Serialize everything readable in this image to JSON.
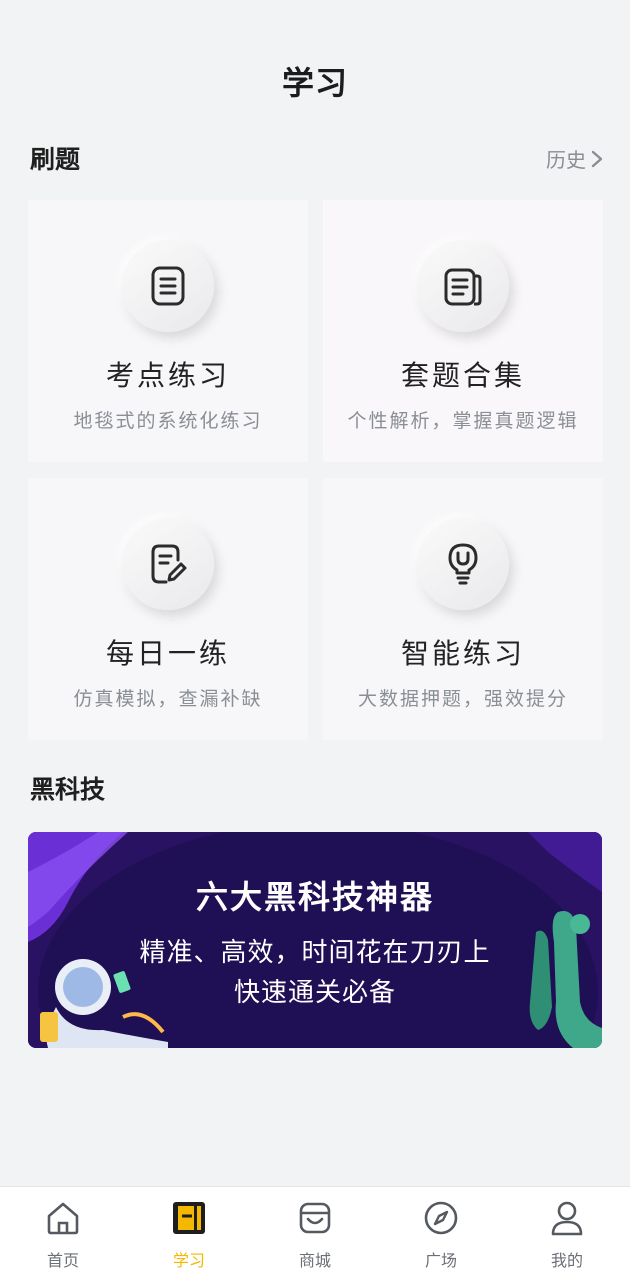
{
  "header": {
    "title": "学习"
  },
  "practice": {
    "section_title": "刷题",
    "history_label": "历史",
    "cards": [
      {
        "title": "考点练习",
        "subtitle": "地毯式的系统化练习",
        "icon": "document-list-icon"
      },
      {
        "title": "套题合集",
        "subtitle": "个性解析，掌握真题逻辑",
        "icon": "paper-stack-icon"
      },
      {
        "title": "每日一练",
        "subtitle": "仿真模拟，查漏补缺",
        "icon": "edit-document-icon"
      },
      {
        "title": "智能练习",
        "subtitle": "大数据押题，强效提分",
        "icon": "lightbulb-icon"
      }
    ]
  },
  "tech": {
    "section_title": "黑科技",
    "banner": {
      "title": "六大黑科技神器",
      "line1": "精准、高效，时间花在刀刃上",
      "line2": "快速通关必备"
    }
  },
  "tabbar": {
    "active_color": "#f5b800",
    "tabs": [
      {
        "label": "首页",
        "icon": "home-icon"
      },
      {
        "label": "学习",
        "icon": "study-icon"
      },
      {
        "label": "商城",
        "icon": "store-icon"
      },
      {
        "label": "广场",
        "icon": "compass-icon"
      },
      {
        "label": "我的",
        "icon": "user-icon"
      }
    ]
  }
}
